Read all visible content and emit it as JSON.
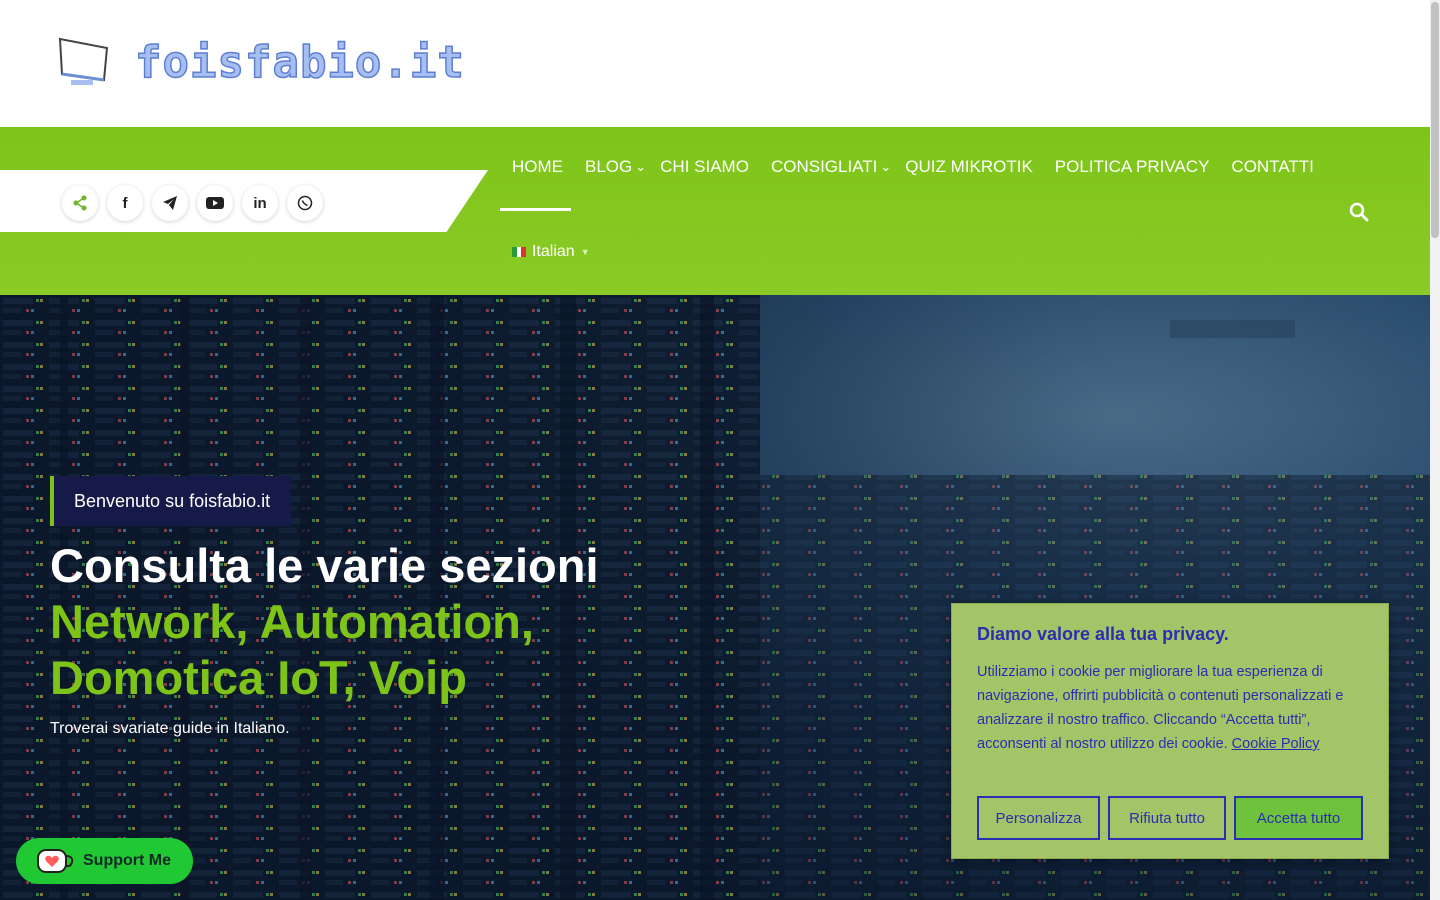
{
  "site": {
    "logo_text": "foisfabio.it"
  },
  "social": [
    {
      "name": "share-icon",
      "glyph": "<"
    },
    {
      "name": "facebook-icon",
      "glyph": "f"
    },
    {
      "name": "telegram-icon",
      "glyph": "➤"
    },
    {
      "name": "youtube-icon",
      "glyph": "▶"
    },
    {
      "name": "linkedin-icon",
      "glyph": "in"
    },
    {
      "name": "whatsapp-icon",
      "glyph": "✆"
    }
  ],
  "nav": {
    "items": [
      {
        "label": "HOME",
        "dropdown": false
      },
      {
        "label": "BLOG",
        "dropdown": true
      },
      {
        "label": "CHI SIAMO",
        "dropdown": false
      },
      {
        "label": "CONSIGLIATI",
        "dropdown": true
      },
      {
        "label": "QUIZ MIKROTIK",
        "dropdown": false
      },
      {
        "label": "POLITICA PRIVACY",
        "dropdown": false
      },
      {
        "label": "CONTATTI",
        "dropdown": false
      }
    ],
    "language": "Italian",
    "active": "HOME"
  },
  "hero": {
    "tag": "Benvenuto su foisfabio.it",
    "title_line1": "Consulta le varie sezioni",
    "title_line2": "Network, Automation, Domotica IoT, Voip",
    "subtitle": "Troverai svariate guide in Italiano."
  },
  "cookie": {
    "title": "Diamo valore alla tua privacy.",
    "text": "Utilizziamo i cookie per migliorare la tua esperienza di navigazione, offrirti pubblicità o contenuti personalizzati e analizzare il nostro traffico. Cliccando “Accetta tutti”, acconsenti al nostro utilizzo dei cookie.",
    "link": "Cookie Policy",
    "buttons": {
      "customize": "Personalizza",
      "reject": "Rifiuta tutto",
      "accept": "Accetta tutto"
    }
  },
  "support": {
    "label": "Support Me"
  },
  "colors": {
    "brand_green": "#7ec418",
    "cookie_blue": "#2a2fb0",
    "cookie_bg": "#a4c468",
    "support_green": "#20c933"
  }
}
